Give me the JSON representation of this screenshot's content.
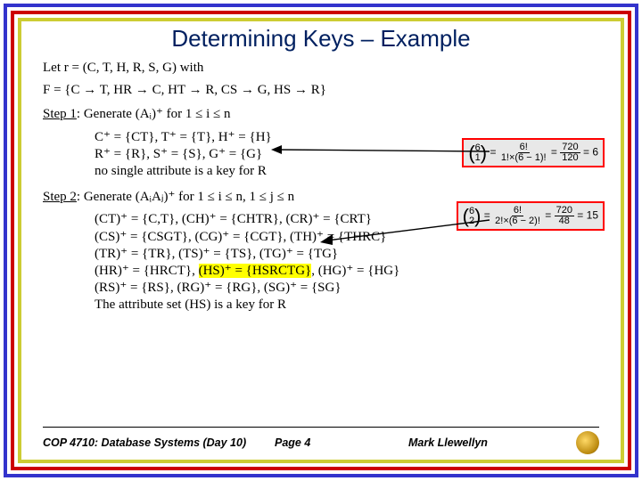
{
  "title": "Determining Keys – Example",
  "given1": "Let r = (C, T, H, R, S, G) with",
  "given2": "F = {C → T, HR → C, HT → R, CS → G, HS → R}",
  "step1_label": "Step 1",
  "step1_rest": ": Generate (Aᵢ)⁺ for 1 ≤ i ≤ n",
  "step1_lines": [
    "C⁺ = {CT},   T⁺ = {T},   H⁺ = {H}",
    "R⁺ = {R},     S⁺ = {S},    G⁺ = {G}",
    "no single attribute is a key for R"
  ],
  "step2_label": "Step 2",
  "step2_rest": ": Generate (AᵢAⱼ)⁺ for 1 ≤ i ≤ n, 1 ≤ j ≤ n",
  "step2_lines_pre": [
    "(CT)⁺ = {C,T},   (CH)⁺ = {CHTR},   (CR)⁺ = {CRT}",
    "(CS)⁺ = {CSGT},   (CG)⁺ = {CGT},    (TH)⁺ = {THRC}",
    "(TR)⁺ = {TR},   (TS)⁺ = {TS},  (TG)⁺ = {TG}"
  ],
  "step2_hl_pre": "(HR)⁺ = {HRCT},   ",
  "step2_hl": "(HS)⁺ = {HSRCTG}",
  "step2_hl_post": ",  (HG)⁺ = {HG}",
  "step2_lines_post": [
    "(RS)⁺ = {RS},   (RG)⁺ = {RG},   (SG)⁺ = {SG}",
    "The attribute set (HS) is a key for R"
  ],
  "box1": {
    "bin_n": "6",
    "bin_k": "1",
    "f1n": "6!",
    "f1d": "1!×(6 − 1)!",
    "f2n": "720",
    "f2d": "120",
    "ans": "6"
  },
  "box2": {
    "bin_n": "6",
    "bin_k": "2",
    "f1n": "6!",
    "f1d": "2!×(6 − 2)!",
    "f2n": "720",
    "f2d": "48",
    "ans": "15"
  },
  "footer": {
    "course": "COP 4710: Database Systems (Day 10)",
    "page": "Page 4",
    "author": "Mark Llewellyn"
  }
}
